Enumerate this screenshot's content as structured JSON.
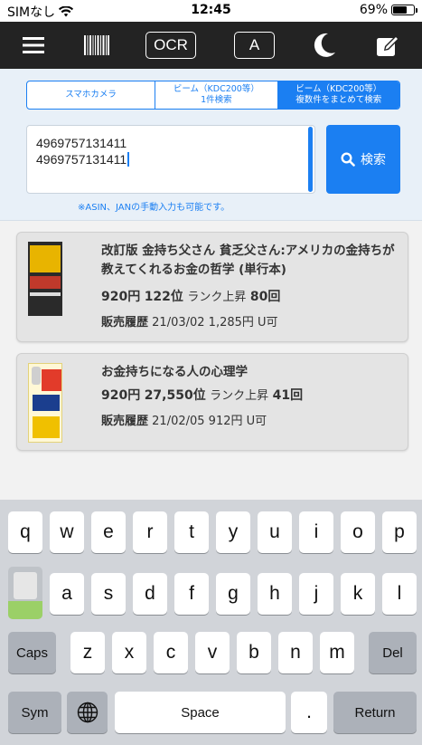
{
  "status_bar": {
    "carrier": "SIMなし",
    "time": "12:45",
    "battery_percent": "69%",
    "battery_level": 0.69
  },
  "toolbar": {
    "ocr_label": "OCR",
    "a_label": "A",
    "icons": [
      "menu-icon",
      "barcode-icon",
      "moon-icon",
      "edit-icon"
    ]
  },
  "mode_tabs": [
    {
      "line1": "スマホカメラ",
      "line2": "",
      "active": false
    },
    {
      "line1": "ビーム（KDC200等）",
      "line2": "1件検索",
      "active": false
    },
    {
      "line1": "ビーム（KDC200等）",
      "line2": "複数件をまとめて検索",
      "active": true
    }
  ],
  "search": {
    "lines": [
      "4969757131411",
      "4969757131411"
    ],
    "button_label": "検索",
    "hint": "※ASIN、JANの手動入力も可能です。"
  },
  "results": [
    {
      "title": "改訂版 金持ち父さん 貧乏父さん:アメリカの金持ちが教えてくれるお金の哲学 (単行本)",
      "price": "920円",
      "rank": "122位",
      "rank_label": "ランク上昇",
      "rank_up": "80回",
      "history_label": "販売履歴",
      "history": "21/03/02 1,285円 U可"
    },
    {
      "title": "お金持ちになる人の心理学",
      "price": "920円",
      "rank": "27,550位",
      "rank_label": "ランク上昇",
      "rank_up": "41回",
      "history_label": "販売履歴",
      "history": "21/02/05 912円 U可"
    }
  ],
  "keyboard": {
    "row1": [
      "q",
      "w",
      "e",
      "r",
      "t",
      "y",
      "u",
      "i",
      "o",
      "p"
    ],
    "row2": [
      "a",
      "s",
      "d",
      "f",
      "g",
      "h",
      "j",
      "k",
      "l"
    ],
    "row3": [
      "z",
      "x",
      "c",
      "v",
      "b",
      "n",
      "m"
    ],
    "caps": "Caps",
    "del": "Del",
    "sym": "Sym",
    "space": "Space",
    "period": ".",
    "return": "Return"
  },
  "colors": {
    "accent": "#1b7ff2",
    "toolbar_bg": "#232323",
    "panel_bg": "#e8f0f8",
    "keyboard_bg": "#d1d4d9"
  }
}
